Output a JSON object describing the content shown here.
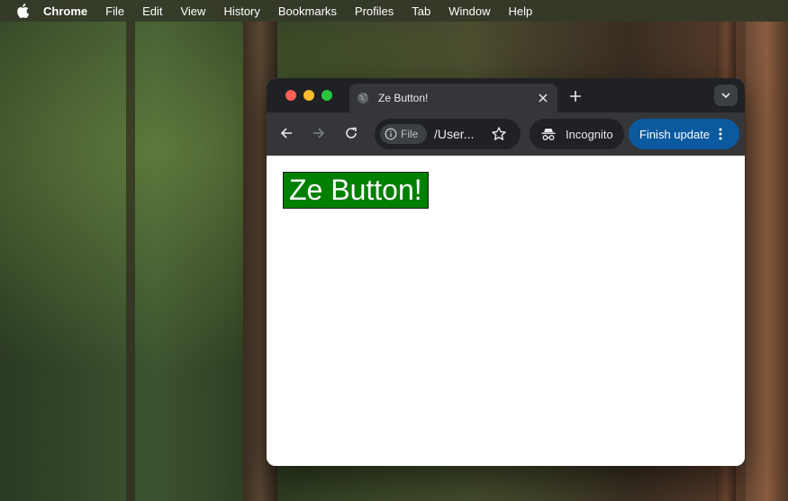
{
  "menubar": {
    "apple_icon": "apple-icon",
    "items": [
      "Chrome",
      "File",
      "Edit",
      "View",
      "History",
      "Bookmarks",
      "Profiles",
      "Tab",
      "Window",
      "Help"
    ]
  },
  "browser": {
    "tab": {
      "title": "Ze Button!",
      "favicon": "globe-icon"
    },
    "toolbar": {
      "site_chip_label": "File",
      "url": "/User...",
      "incognito_label": "Incognito",
      "finish_update_label": "Finish update"
    }
  },
  "page": {
    "button_label": "Ze Button!"
  },
  "colors": {
    "button_bg": "#008000",
    "finish_update_bg": "#0b5aa0",
    "traffic_red": "#ff5f57",
    "traffic_yellow": "#febc2e",
    "traffic_green": "#28c840"
  }
}
